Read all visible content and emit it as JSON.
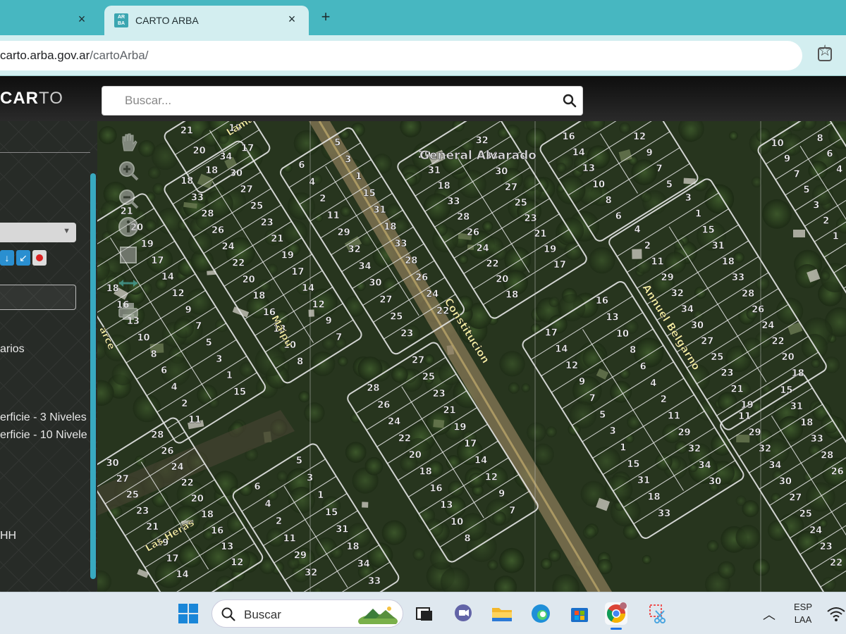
{
  "browser": {
    "tabs": [
      {
        "label": "",
        "active": false
      },
      {
        "label": "CARTO ARBA",
        "active": true,
        "favicon": "ARBA"
      }
    ],
    "close_glyph": "×",
    "new_tab_glyph": "+",
    "url_host": "carto.arba.gov.ar",
    "url_path": "/cartoArba/"
  },
  "app": {
    "logo_bold": "CAR",
    "logo_light": "TO",
    "search_placeholder": "Buscar..."
  },
  "panel": {
    "texts": [
      "arios",
      "erficie - 3 Niveles",
      "erficie - 10 Nivele",
      "HH"
    ]
  },
  "map": {
    "street_labels": [
      "General Alvarado",
      "Constitucion",
      "Annuel Belgarno",
      "Maipu",
      "Las Heras",
      "Lama",
      "arce"
    ],
    "lot_numbers": [
      "18",
      "34",
      "33",
      "30",
      "28",
      "27",
      "26",
      "25",
      "24",
      "23",
      "22",
      "21",
      "20",
      "19",
      "18",
      "17",
      "16",
      "14",
      "13",
      "12",
      "10",
      "9",
      "8",
      "7",
      "6",
      "5",
      "4",
      "3",
      "2",
      "1",
      "11",
      "15",
      "29",
      "31",
      "32"
    ]
  },
  "taskbar": {
    "search_label": "Buscar",
    "lang_top": "ESP",
    "lang_bottom": "LAA"
  },
  "colors": {
    "chrome_accent": "#47b7c1",
    "tab_active": "#d3eef0",
    "panel_scroll": "#38a9c0",
    "parcel_line": "#e6e6e6",
    "street_label": "#f4f0a0"
  }
}
